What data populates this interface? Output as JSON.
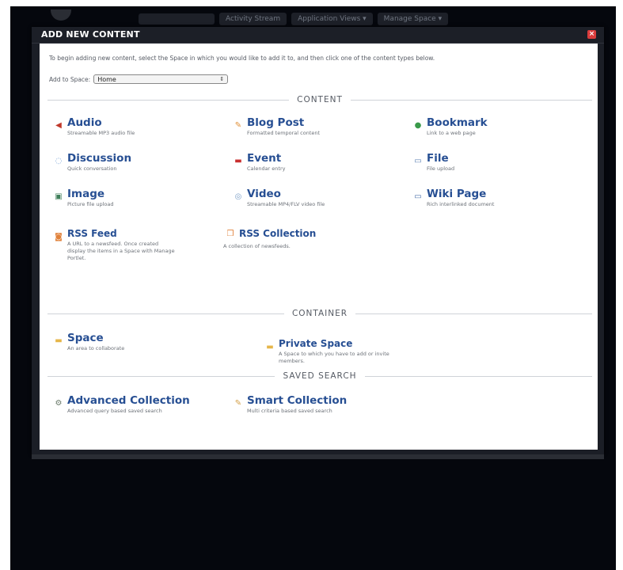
{
  "topnav": {
    "items": [
      "",
      "Activity Stream",
      "Application Views ▾",
      "Manage Space ▾"
    ]
  },
  "dialog": {
    "title": "ADD NEW CONTENT",
    "intro": "To begin adding new content, select the Space in which you would like to add it to, and then click one of the content types below.",
    "space_label": "Add to Space:",
    "space_value": "Home"
  },
  "sections": {
    "content": "CONTENT",
    "container": "CONTAINER",
    "saved_search": "SAVED SEARCH"
  },
  "content_items": [
    {
      "name": "Audio",
      "desc": "Streamable MP3 audio file",
      "icon": "speaker-icon"
    },
    {
      "name": "Blog Post",
      "desc": "Formatted temporal content",
      "icon": "blog-icon"
    },
    {
      "name": "Bookmark",
      "desc": "Link to a web page",
      "icon": "bookmark-icon"
    },
    {
      "name": "Discussion",
      "desc": "Quick conversation",
      "icon": "chat-icon"
    },
    {
      "name": "Event",
      "desc": "Calendar entry",
      "icon": "calendar-icon"
    },
    {
      "name": "File",
      "desc": "File upload",
      "icon": "file-icon"
    },
    {
      "name": "Image",
      "desc": "Picture file upload",
      "icon": "image-icon"
    },
    {
      "name": "Video",
      "desc": "Streamable MP4/FLV video file",
      "icon": "video-icon"
    },
    {
      "name": "Wiki Page",
      "desc": "Rich interlinked document",
      "icon": "wiki-icon"
    },
    {
      "name": "RSS Feed",
      "desc": "A URL to a newsfeed. Once created display the items in a Space with Manage Portlet.",
      "icon": "rss-icon"
    },
    {
      "name": "RSS Collection",
      "desc": "A collection of newsfeeds.",
      "icon": "rss-collection-icon"
    }
  ],
  "container_items": [
    {
      "name": "Space",
      "desc": "An area to collaborate",
      "icon": "folder-icon"
    },
    {
      "name": "Private Space",
      "desc": "A Space to which you have to add or invite members.",
      "icon": "private-folder-icon"
    }
  ],
  "saved_search_items": [
    {
      "name": "Advanced Collection",
      "desc": "Advanced query based saved search",
      "icon": "advanced-search-icon"
    },
    {
      "name": "Smart Collection",
      "desc": "Multi criteria based saved search",
      "icon": "smart-search-icon"
    }
  ],
  "colors": {
    "backdrop": "#05070d",
    "link": "#274f93",
    "close": "#d93c3c"
  }
}
